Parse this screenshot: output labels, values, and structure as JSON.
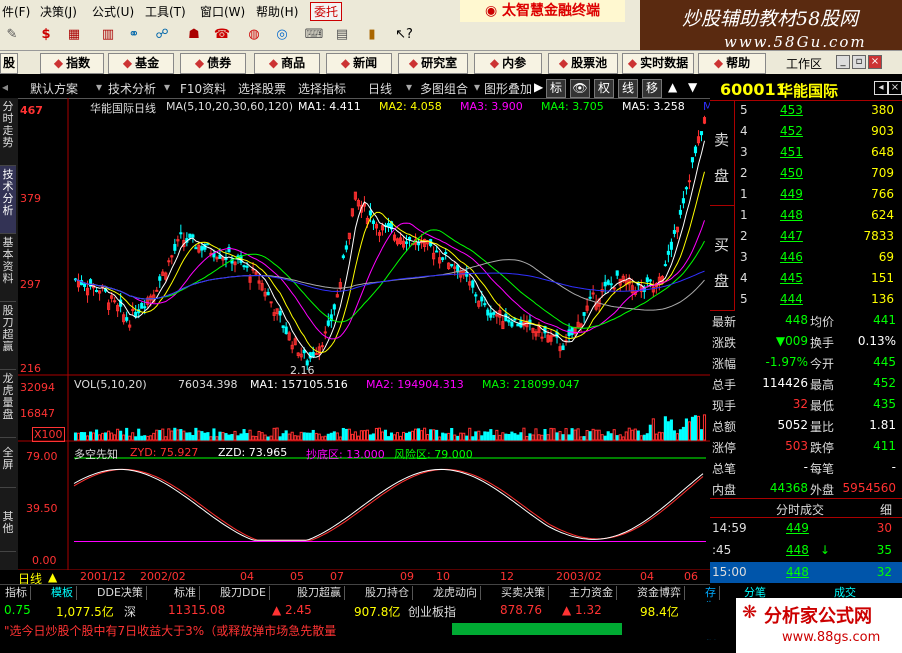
{
  "menubar": {
    "items": [
      "件(F)",
      "决策(J)",
      "公式(U)",
      "工具(T)",
      "窗口(W)",
      "帮助(H)"
    ],
    "entrust": "委托",
    "brand": "太智慧金融终端"
  },
  "banner": {
    "line1": "炒股辅助教材58股网",
    "line2": "www.58Gu.com"
  },
  "toolbar": {
    "icons": [
      "pencil-icon",
      "dollar-icon",
      "grid-icon",
      "chart-icon",
      "binoculars-icon",
      "network-icon",
      "people-icon",
      "phone-icon",
      "globe-icon",
      "target-icon",
      "keyboard-icon",
      "newspaper-icon",
      "books-icon",
      "help-pointer-icon"
    ]
  },
  "navbar": {
    "items": [
      "股",
      "指数",
      "基金",
      "债券",
      "商品",
      "新闻",
      "研究室",
      "内参",
      "股票池",
      "实时数据",
      "帮助"
    ],
    "workspace": "工作区"
  },
  "chartbar": {
    "default_scheme": "默认方案",
    "tech_analysis": "技术分析",
    "f10": "F10资料",
    "select_stock": "选择股票",
    "select_indicator": "选择指标",
    "period": "日线",
    "multi_chart": "多图组合",
    "overlay": "图形叠加",
    "buttons": [
      "标",
      "👁",
      "权",
      "线",
      "移"
    ]
  },
  "lefttabs": [
    "分时走势",
    "技术分析",
    "基本资料",
    "股刀超赢",
    "龙虎量盘",
    "全屏",
    "其他"
  ],
  "chart": {
    "title": "华能国际日线",
    "ma_label": "MA(5,10,20,30,60,120)",
    "ma_values": [
      {
        "name": "MA1:",
        "value": "4.411",
        "color": "#ffffff"
      },
      {
        "name": "MA2:",
        "value": "4.058",
        "color": "#ffff00"
      },
      {
        "name": "MA3:",
        "value": "3.900",
        "color": "#ff00ff"
      },
      {
        "name": "MA4:",
        "value": "3.705",
        "color": "#00ff00"
      },
      {
        "name": "MA5:",
        "value": "3.258",
        "color": "#ffffff"
      },
      {
        "name": "MA6:",
        "value": "",
        "color": "#3030ff"
      }
    ],
    "price_axis": [
      "467",
      "379",
      "297",
      "216"
    ],
    "low_marker": "2.16",
    "vol_label": "VOL(5,10,20)",
    "vol_value": "76034.398",
    "vol_ma": [
      {
        "name": "MA1:",
        "value": "157105.516",
        "color": "#ffffff"
      },
      {
        "name": "MA2:",
        "value": "194904.313",
        "color": "#ff00ff"
      },
      {
        "name": "MA3:",
        "value": "218099.047",
        "color": "#00ff00"
      }
    ],
    "vol_axis": [
      "32094",
      "16847",
      "X100"
    ],
    "ind_label": "多空先知",
    "ind_values": [
      {
        "name": "ZYD:",
        "value": "75.927",
        "color": "#ff3030"
      },
      {
        "name": "ZZD:",
        "value": "73.965",
        "color": "#ffffff"
      },
      {
        "name": "抄底区:",
        "value": "13.000",
        "color": "#ff00ff"
      },
      {
        "name": "风险区:",
        "value": "79.000",
        "color": "#00ff00"
      }
    ],
    "ind_axis": [
      "79.00",
      "39.50",
      "0.00"
    ],
    "period_label": "日线",
    "dates": [
      "2001/12",
      "2002/02",
      "04",
      "05",
      "07",
      "09",
      "10",
      "12",
      "2003/02",
      "04",
      "06"
    ]
  },
  "rpanel": {
    "code": "600011",
    "name": "华能国际",
    "sell_label": "卖盘",
    "buy_label": "买盘",
    "sells": [
      {
        "level": "5",
        "price": "453",
        "vol": "380"
      },
      {
        "level": "4",
        "price": "452",
        "vol": "903"
      },
      {
        "level": "3",
        "price": "451",
        "vol": "648"
      },
      {
        "level": "2",
        "price": "450",
        "vol": "709"
      },
      {
        "level": "1",
        "price": "449",
        "vol": "766"
      }
    ],
    "buys": [
      {
        "level": "1",
        "price": "448",
        "vol": "624"
      },
      {
        "level": "2",
        "price": "447",
        "vol": "7833"
      },
      {
        "level": "3",
        "price": "446",
        "vol": "69"
      },
      {
        "level": "4",
        "price": "445",
        "vol": "151"
      },
      {
        "level": "5",
        "price": "444",
        "vol": "136"
      }
    ],
    "stats": [
      {
        "l": "最新",
        "lv": "448",
        "lc": "#00ff00",
        "r": "均价",
        "rv": "441",
        "rc": "#00ff00"
      },
      {
        "l": "涨跌",
        "lv": "▼009",
        "lc": "#00ff00",
        "r": "换手",
        "rv": "0.13%",
        "rc": "#ffffff"
      },
      {
        "l": "涨幅",
        "lv": "-1.97%",
        "lc": "#00ff00",
        "r": "今开",
        "rv": "445",
        "rc": "#00ff00"
      },
      {
        "l": "总手",
        "lv": "114426",
        "lc": "#ffffff",
        "r": "最高",
        "rv": "452",
        "rc": "#00ff00"
      },
      {
        "l": "现手",
        "lv": "32",
        "lc": "#ff3030",
        "r": "最低",
        "rv": "435",
        "rc": "#00ff00"
      },
      {
        "l": "总额",
        "lv": "5052",
        "lc": "#ffffff",
        "r": "量比",
        "rv": "1.81",
        "rc": "#ffffff"
      },
      {
        "l": "涨停",
        "lv": "503",
        "lc": "#ff3030",
        "r": "跌停",
        "rv": "411",
        "rc": "#00ff00"
      },
      {
        "l": "总笔",
        "lv": "-",
        "lc": "#ffffff",
        "r": "每笔",
        "rv": "-",
        "rc": "#ffffff"
      },
      {
        "l": "内盘",
        "lv": "44368",
        "lc": "#00ff00",
        "r": "外盘",
        "rv": "5954560",
        "rc": "#ff3030"
      }
    ],
    "trades_title": "分时成交",
    "trades_detail": "细",
    "trades": [
      {
        "time": "14:59",
        "price": "449",
        "vol": "30",
        "vc": "#ff3030",
        "arrow": ""
      },
      {
        "time": ":45",
        "price": "448",
        "vol": "35",
        "vc": "#00ff00",
        "arrow": "↓"
      },
      {
        "time": "15:00",
        "price": "448",
        "vol": "32",
        "vc": "#00ff00",
        "arrow": ""
      }
    ],
    "tabs": [
      "分笔",
      "成交"
    ]
  },
  "bottabs": [
    "指标",
    "模板",
    "DDE决策",
    "标准",
    "股刀DDE",
    "股刀超赢",
    "股刀持仓",
    "龙虎动向",
    "买卖决策",
    "主力资金",
    "资金博弈",
    "存为模板"
  ],
  "statusbar": {
    "v1": "0.75",
    "v2": "1,077.5亿",
    "v3": "深",
    "v4": "11315.08",
    "v5": "▲ 2.45",
    "v6": "907.8亿",
    "v7": "创业板指",
    "v8": "878.76",
    "v9": "▲ 1.32",
    "v10": "98.4亿"
  },
  "ticker": {
    "text": "\"选今日炒股个股中有7日收益大于3%（或释放弹市场急先散量"
  },
  "watermark": {
    "line1": "分析家公式网",
    "line2": "www.88gs.com"
  },
  "colors": {
    "up": "#ff3030",
    "down": "#00ff00",
    "bg": "#000000",
    "panel": "#ece9d8"
  }
}
